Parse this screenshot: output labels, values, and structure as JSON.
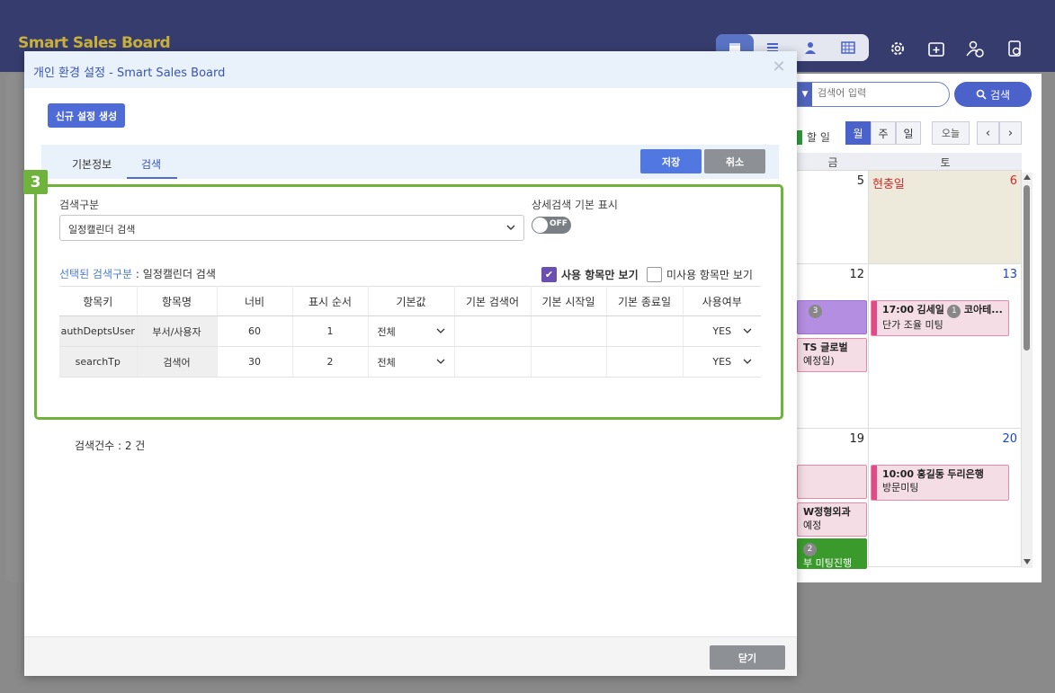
{
  "app": {
    "title": "Smart Sales Board",
    "colors": {
      "header": "#363c6d",
      "accent": "#4f6bd8",
      "callout": "#6fb23c"
    }
  },
  "background_calendar": {
    "search_placeholder": "검색어 입력",
    "search_button": "검색",
    "legend_label": "할 일",
    "view_buttons": [
      "월",
      "주",
      "일"
    ],
    "active_view": "월",
    "today_button": "오늘",
    "day_headers": [
      "금",
      "토"
    ],
    "rows": [
      {
        "fri_day": "5",
        "sat_day": "6",
        "sat_holiday": "현충일",
        "events": []
      },
      {
        "fri_day": "12",
        "sat_day": "13",
        "fri_events": [
          {
            "badge": "3"
          },
          {
            "title": "TS 글로벌",
            "sub": "예정일)"
          }
        ],
        "sat_events": [
          {
            "time": "17:00",
            "person": "김세일",
            "badge": "1",
            "company": "코아테...",
            "desc": "단가 조율 미팅"
          }
        ]
      },
      {
        "fri_day": "19",
        "sat_day": "20",
        "fri_events": [
          {
            "title": "W정형외과",
            "sub": "예정"
          },
          {
            "badge": "2",
            "title": "부 미팅진행"
          }
        ],
        "sat_events": [
          {
            "time": "10:00",
            "person": "홍길동",
            "company": "두리은행",
            "desc": "방문미팅"
          }
        ]
      }
    ]
  },
  "modal": {
    "title": "개인 환경 설정 - Smart Sales Board",
    "new_button": "신규 설정 생성",
    "tabs": [
      {
        "label": "기본정보",
        "active": false
      },
      {
        "label": "검색",
        "active": true
      }
    ],
    "save_button": "저장",
    "cancel_button": "취소",
    "callout_number": "3",
    "search_type": {
      "label": "검색구분",
      "value": "일정캘린더 검색"
    },
    "detail_default": {
      "label": "상세검색 기본 표시",
      "toggle_text": "OFF",
      "on": false
    },
    "selected": {
      "prefix": "선택된 검색구분",
      "separator": " : ",
      "value": "일정캘린더 검색"
    },
    "filters": {
      "used_only": {
        "label": "사용 항목만 보기",
        "checked": true
      },
      "unused_only": {
        "label": "미사용 항목만 보기",
        "checked": false
      }
    },
    "table": {
      "columns": [
        "항목키",
        "항목명",
        "너비",
        "표시 순서",
        "기본값",
        "기본 검색어",
        "기본 시작일",
        "기본 종료일",
        "사용여부"
      ],
      "rows": [
        {
          "key": "authDeptsUser",
          "name": "부서/사용자",
          "width": "60",
          "order": "1",
          "default": "전체",
          "keyword": "",
          "start": "",
          "end": "",
          "use": "YES"
        },
        {
          "key": "searchTp",
          "name": "검색어",
          "width": "30",
          "order": "2",
          "default": "전체",
          "keyword": "",
          "start": "",
          "end": "",
          "use": "YES"
        }
      ]
    },
    "count_label": "검색건수 : 2 건",
    "close_button": "닫기"
  }
}
